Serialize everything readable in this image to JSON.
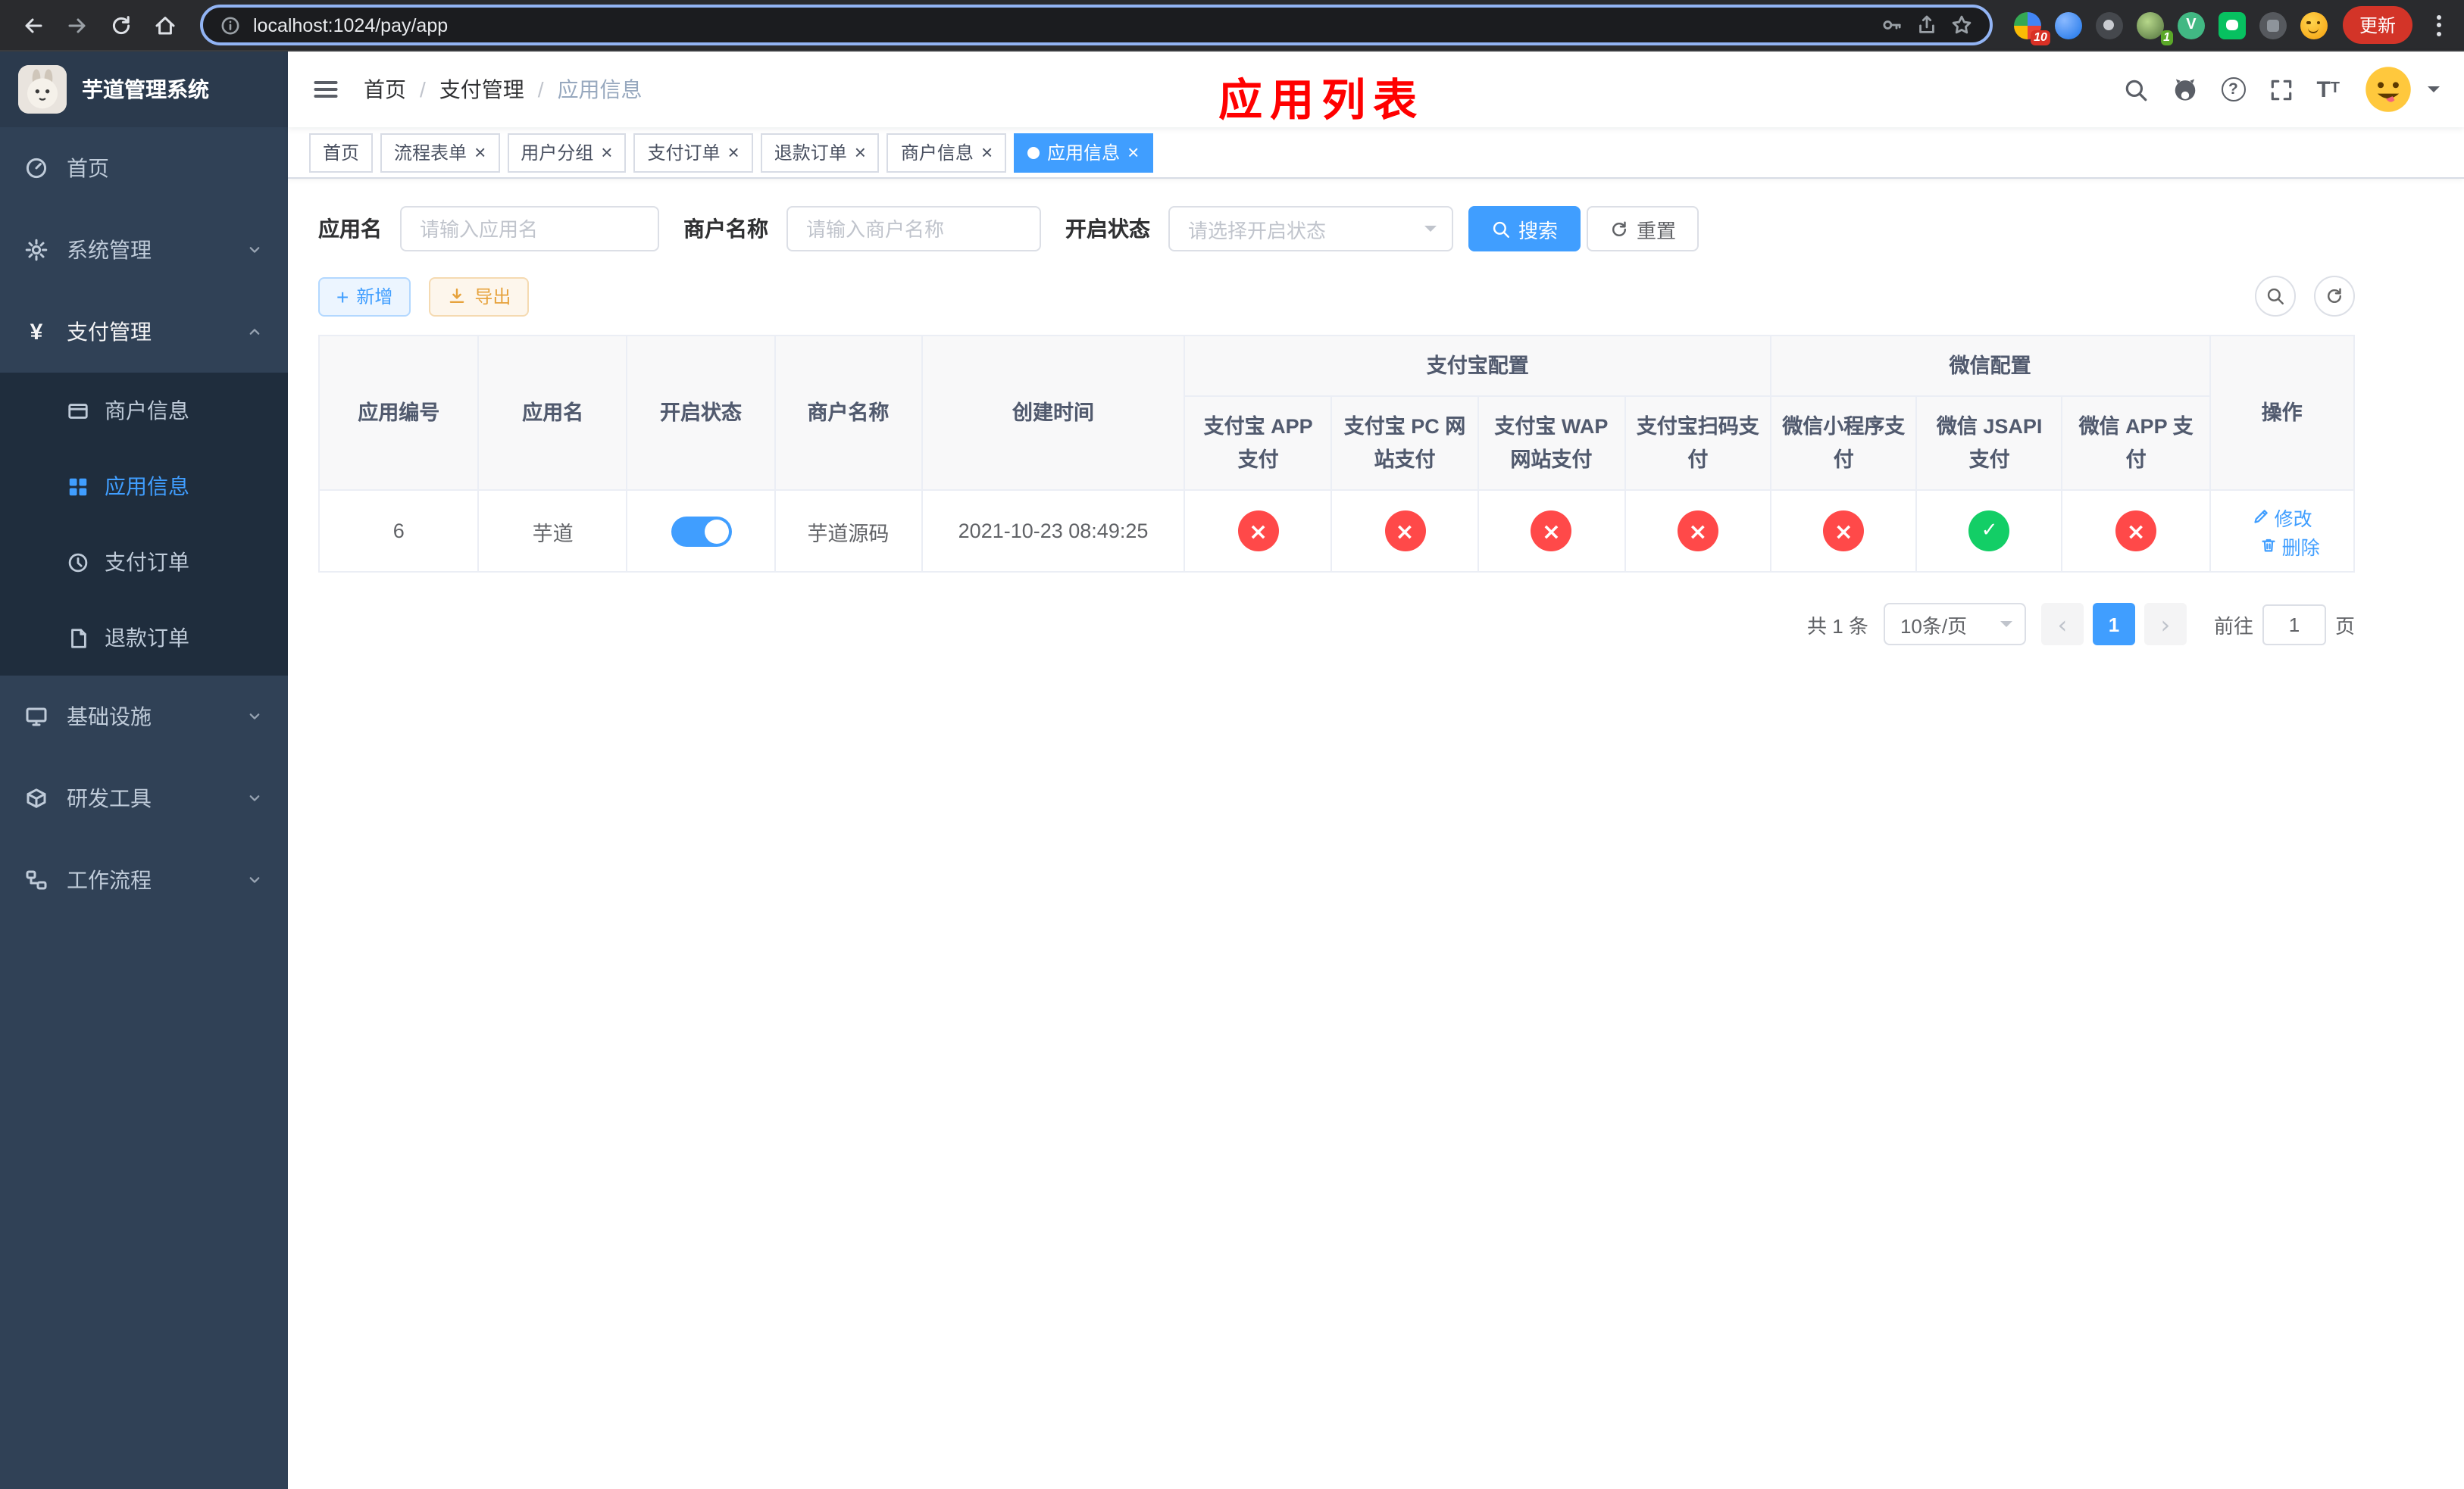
{
  "colors": {
    "accent": "#409eff",
    "danger": "#ff4949",
    "success": "#13ce66",
    "warning": "#e6a23c",
    "page_title_red": "#ff0000",
    "sidebar_bg": "#304156",
    "submenu_bg": "#1f2d3d"
  },
  "browser": {
    "url": "localhost:1024/pay/app",
    "update_label": "更新",
    "ext_badge_puzzle": "10",
    "ext_badge_avatar": "1",
    "vue_ext_glyph": "V"
  },
  "sidebar": {
    "logo_title": "芋道管理系统",
    "items": [
      {
        "label": "首页"
      },
      {
        "label": "系统管理"
      },
      {
        "label": "支付管理"
      },
      {
        "label": "基础设施"
      },
      {
        "label": "研发工具"
      },
      {
        "label": "工作流程"
      }
    ],
    "pay_children": [
      {
        "label": "商户信息"
      },
      {
        "label": "应用信息"
      },
      {
        "label": "支付订单"
      },
      {
        "label": "退款订单"
      }
    ]
  },
  "header": {
    "breadcrumb": [
      "首页",
      "支付管理",
      "应用信息"
    ],
    "separator": "/",
    "page_title": "应用列表"
  },
  "tabs": [
    {
      "label": "首页"
    },
    {
      "label": "流程表单"
    },
    {
      "label": "用户分组"
    },
    {
      "label": "支付订单"
    },
    {
      "label": "退款订单"
    },
    {
      "label": "商户信息"
    },
    {
      "label": "应用信息"
    }
  ],
  "filters": {
    "app_name": {
      "label": "应用名",
      "placeholder": "请输入应用名",
      "value": ""
    },
    "merchant_name": {
      "label": "商户名称",
      "placeholder": "请输入商户名称",
      "value": ""
    },
    "status": {
      "label": "开启状态",
      "placeholder": "请选择开启状态"
    },
    "search_label": "搜索",
    "reset_label": "重置"
  },
  "toolbar": {
    "add_label": "新增",
    "export_label": "导出"
  },
  "table": {
    "groups": {
      "alipay": "支付宝配置",
      "wechat": "微信配置",
      "actions": "操作"
    },
    "columns": {
      "id": "应用编号",
      "name": "应用名",
      "status": "开启状态",
      "merchant": "商户名称",
      "created": "创建时间",
      "alipay_app": "支付宝 APP 支付",
      "alipay_pc": "支付宝 PC 网站支付",
      "alipay_wap": "支付宝 WAP 网站支付",
      "alipay_qr": "支付宝扫码支付",
      "wx_mini": "微信小程序支付",
      "wx_jsapi": "微信 JSAPI 支付",
      "wx_app": "微信 APP 支付"
    },
    "rows": [
      {
        "id": "6",
        "name": "芋道",
        "status_on": true,
        "merchant": "芋道源码",
        "created": "2021-10-23 08:49:25",
        "configs": {
          "alipay_app": "no",
          "alipay_pc": "no",
          "alipay_wap": "no",
          "alipay_qr": "no",
          "wx_mini": "no",
          "wx_jsapi": "yes",
          "wx_app": "no"
        },
        "edit_label": "修改",
        "delete_label": "删除"
      }
    ]
  },
  "pagination": {
    "total": "共 1 条",
    "page_size": "10条/页",
    "page": "1",
    "goto": "前往",
    "goto_value": "1",
    "unit": "页"
  }
}
